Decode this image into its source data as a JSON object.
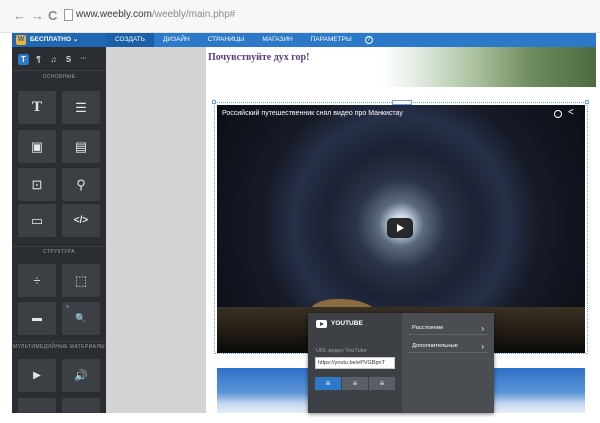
{
  "browser": {
    "back_glyph": "←",
    "forward_glyph": "→",
    "reload_glyph": "C",
    "url_host": "www.weebly.com",
    "url_path": "/weebly/main.php#"
  },
  "topbar": {
    "brand_label": "БЕСПЛАТНО ⌄",
    "brand_logo": "W",
    "menu": [
      {
        "label": "СОЗДАТЬ"
      },
      {
        "label": "ДИЗАЙН"
      },
      {
        "label": "СТРАНИЦЫ"
      },
      {
        "label": "МАГАЗИН"
      },
      {
        "label": "ПАРАМЕТРЫ"
      }
    ],
    "help_glyph": "?"
  },
  "sidebar": {
    "tabs": [
      {
        "glyph": "T",
        "icon": "text-tab-icon"
      },
      {
        "glyph": "¶",
        "icon": "page-tab-icon"
      },
      {
        "glyph": "♫",
        "icon": "media-tab-icon"
      },
      {
        "glyph": "S",
        "icon": "store-tab-icon"
      },
      {
        "glyph": "···",
        "icon": "more-tab-icon"
      }
    ],
    "sections": {
      "basic": "ОСНОВНЫЕ",
      "structure": "СТРУКТУРА",
      "media": "МУЛЬТИМЕДИЙНЫЕ МАТЕРИАЛЫ"
    },
    "basic_tiles": [
      {
        "glyph": "T",
        "icon": "title-icon"
      },
      {
        "glyph": "☰",
        "icon": "text-icon"
      },
      {
        "glyph": "▣",
        "icon": "image-icon"
      },
      {
        "glyph": "▤",
        "icon": "image-text-icon"
      },
      {
        "glyph": "⊡",
        "icon": "gallery-icon"
      },
      {
        "glyph": "⚲",
        "icon": "map-icon"
      },
      {
        "glyph": "▭",
        "icon": "button-icon"
      },
      {
        "glyph": "</>",
        "icon": "embed-code-icon"
      }
    ],
    "structure_tiles": [
      {
        "glyph": "÷",
        "icon": "divider-icon"
      },
      {
        "glyph": "⬚",
        "icon": "spacer-icon"
      },
      {
        "glyph": "▬",
        "icon": "button-block-icon"
      },
      {
        "glyph": "🔍",
        "icon": "search-icon"
      }
    ],
    "media_tiles": [
      {
        "glyph": "▶",
        "icon": "video-icon"
      },
      {
        "glyph": "🔊",
        "icon": "audio-icon"
      }
    ]
  },
  "page": {
    "title": "Почувствуйте дух гор!"
  },
  "video": {
    "title": "Российский путешественник снял видео про Манкистау"
  },
  "popover": {
    "title": "YOUTUBE",
    "field_label": "URL видео YouTube",
    "url_value": "https://youtu.be/ePVGBpnT",
    "align_options": [
      {
        "glyph": "≡",
        "icon": "align-left-icon"
      },
      {
        "glyph": "≡",
        "icon": "align-center-icon"
      },
      {
        "glyph": "≡",
        "icon": "align-right-icon"
      }
    ],
    "menu": [
      {
        "label": "Расстояние"
      },
      {
        "label": "Дополнительные"
      }
    ]
  }
}
